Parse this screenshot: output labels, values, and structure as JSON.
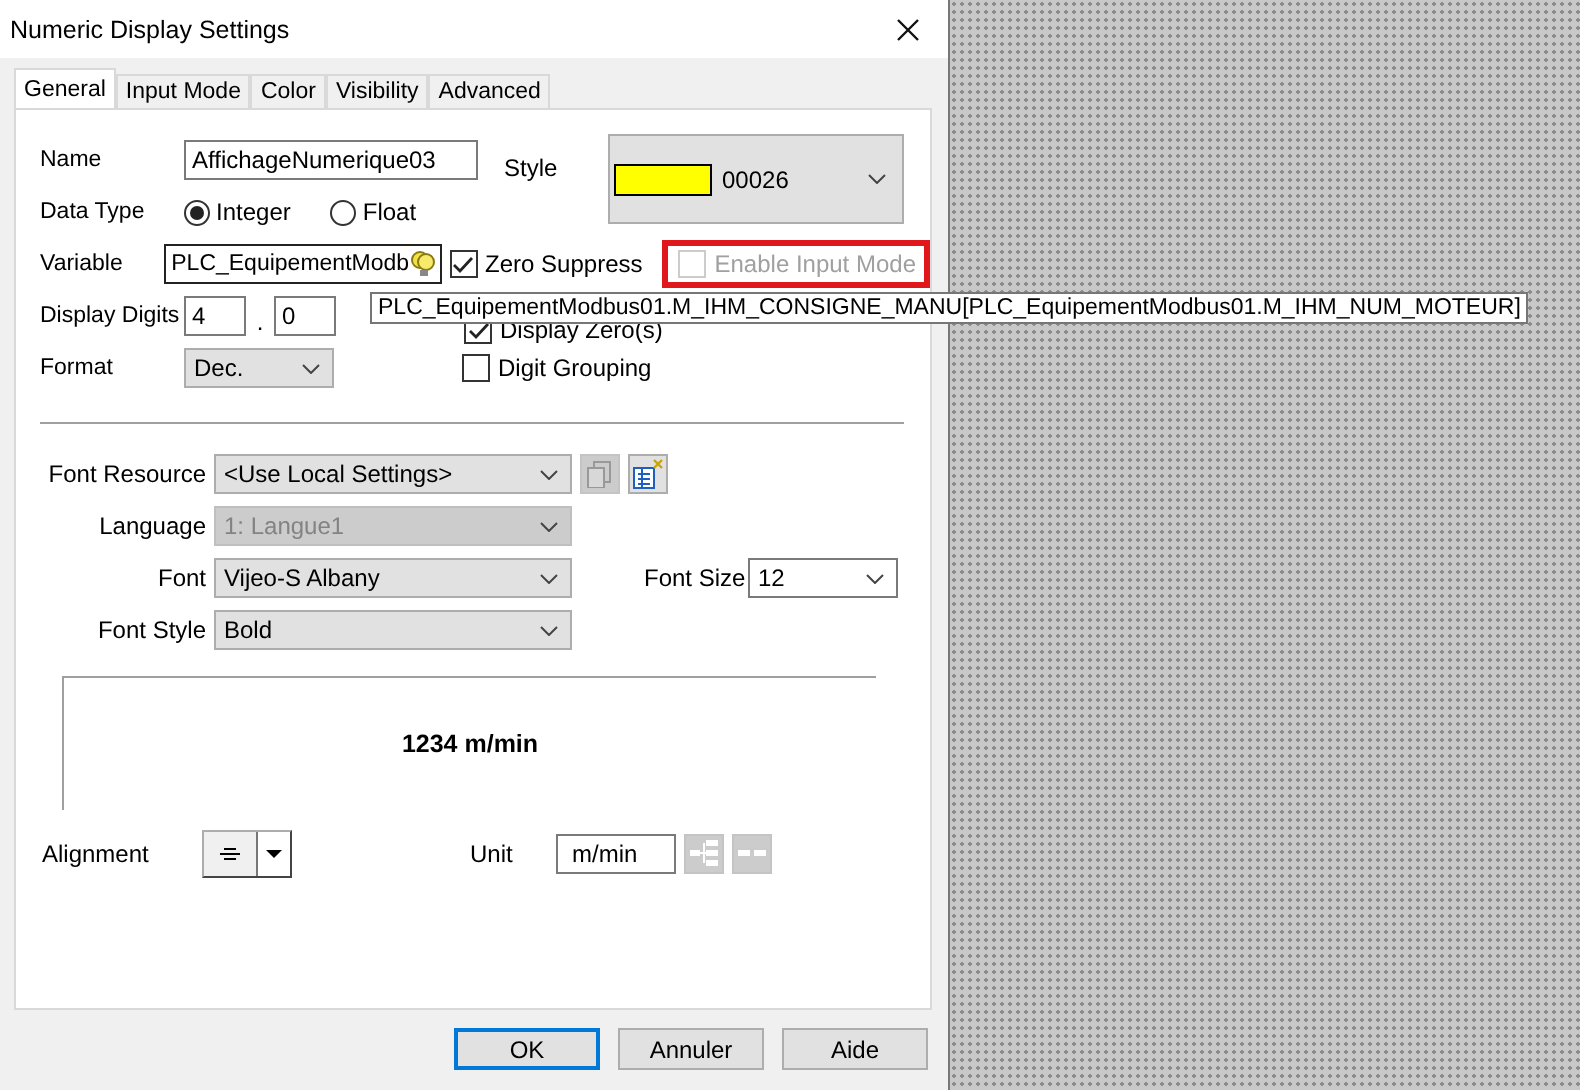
{
  "window": {
    "title": "Numeric Display Settings"
  },
  "tabs": [
    {
      "label": "General",
      "selected": true
    },
    {
      "label": "Input Mode",
      "selected": false
    },
    {
      "label": "Color",
      "selected": false
    },
    {
      "label": "Visibility",
      "selected": false
    },
    {
      "label": "Advanced",
      "selected": false
    }
  ],
  "name": {
    "label": "Name",
    "value": "AffichageNumerique03"
  },
  "style": {
    "label": "Style",
    "value": "00026",
    "color": "#ffff00"
  },
  "data_type": {
    "label": "Data Type",
    "options": [
      {
        "label": "Integer",
        "selected": true
      },
      {
        "label": "Float",
        "selected": false
      }
    ]
  },
  "variable": {
    "label": "Variable",
    "value": "PLC_EquipementModb"
  },
  "zero_suppress": {
    "label": "Zero Suppress",
    "checked": true,
    "disabled": false
  },
  "enable_input_mode": {
    "label": "Enable Input Mode",
    "checked": false,
    "disabled": true,
    "highlighted": true
  },
  "display_digits": {
    "label": "Display Digits",
    "integer": "4",
    "separator": ".",
    "decimal": "0"
  },
  "display_zeros": {
    "label": "Display Zero(s)",
    "checked": true,
    "disabled": false
  },
  "format": {
    "label": "Format",
    "value": "Dec."
  },
  "digit_grouping": {
    "label": "Digit Grouping",
    "checked": false,
    "disabled": false
  },
  "tooltip": {
    "text": "PLC_EquipementModbus01.M_IHM_CONSIGNE_MANU[PLC_EquipementModbus01.M_IHM_NUM_MOTEUR]"
  },
  "font_resource": {
    "label": "Font Resource",
    "value": "<Use Local Settings>"
  },
  "language": {
    "label": "Language",
    "value": "1: Langue1",
    "disabled": true
  },
  "font": {
    "label": "Font",
    "value": "Vijeo-S Albany"
  },
  "font_size": {
    "label": "Font Size",
    "value": "12"
  },
  "font_style": {
    "label": "Font Style",
    "value": "Bold"
  },
  "preview": {
    "text": "1234 m/min"
  },
  "alignment": {
    "label": "Alignment"
  },
  "unit": {
    "label": "Unit",
    "value": "m/min"
  },
  "buttons": [
    {
      "label": "OK",
      "default": true
    },
    {
      "label": "Annuler",
      "default": false
    },
    {
      "label": "Aide",
      "default": false
    }
  ]
}
